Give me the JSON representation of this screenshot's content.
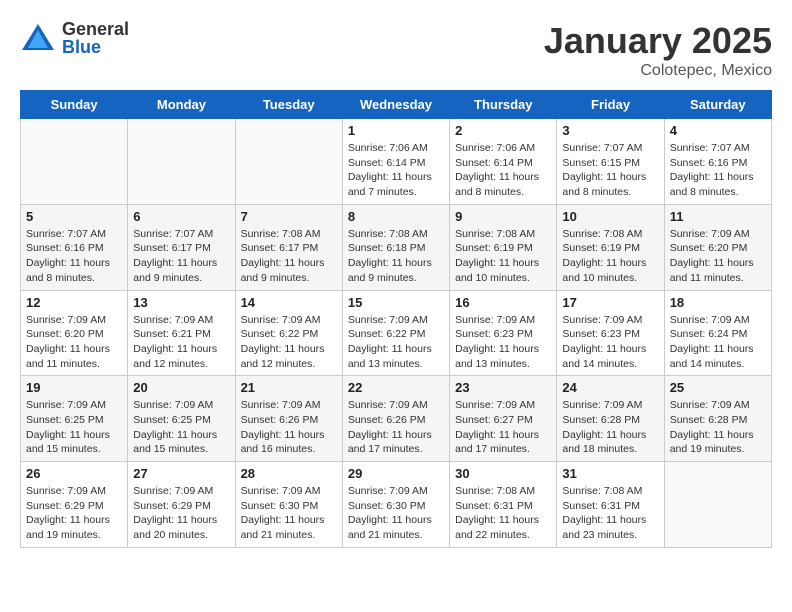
{
  "logo": {
    "general": "General",
    "blue": "Blue"
  },
  "header": {
    "title": "January 2025",
    "subtitle": "Colotepec, Mexico"
  },
  "days_of_week": [
    "Sunday",
    "Monday",
    "Tuesday",
    "Wednesday",
    "Thursday",
    "Friday",
    "Saturday"
  ],
  "weeks": [
    [
      {
        "day": "",
        "info": ""
      },
      {
        "day": "",
        "info": ""
      },
      {
        "day": "",
        "info": ""
      },
      {
        "day": "1",
        "info": "Sunrise: 7:06 AM\nSunset: 6:14 PM\nDaylight: 11 hours\nand 7 minutes."
      },
      {
        "day": "2",
        "info": "Sunrise: 7:06 AM\nSunset: 6:14 PM\nDaylight: 11 hours\nand 8 minutes."
      },
      {
        "day": "3",
        "info": "Sunrise: 7:07 AM\nSunset: 6:15 PM\nDaylight: 11 hours\nand 8 minutes."
      },
      {
        "day": "4",
        "info": "Sunrise: 7:07 AM\nSunset: 6:16 PM\nDaylight: 11 hours\nand 8 minutes."
      }
    ],
    [
      {
        "day": "5",
        "info": "Sunrise: 7:07 AM\nSunset: 6:16 PM\nDaylight: 11 hours\nand 8 minutes."
      },
      {
        "day": "6",
        "info": "Sunrise: 7:07 AM\nSunset: 6:17 PM\nDaylight: 11 hours\nand 9 minutes."
      },
      {
        "day": "7",
        "info": "Sunrise: 7:08 AM\nSunset: 6:17 PM\nDaylight: 11 hours\nand 9 minutes."
      },
      {
        "day": "8",
        "info": "Sunrise: 7:08 AM\nSunset: 6:18 PM\nDaylight: 11 hours\nand 9 minutes."
      },
      {
        "day": "9",
        "info": "Sunrise: 7:08 AM\nSunset: 6:19 PM\nDaylight: 11 hours\nand 10 minutes."
      },
      {
        "day": "10",
        "info": "Sunrise: 7:08 AM\nSunset: 6:19 PM\nDaylight: 11 hours\nand 10 minutes."
      },
      {
        "day": "11",
        "info": "Sunrise: 7:09 AM\nSunset: 6:20 PM\nDaylight: 11 hours\nand 11 minutes."
      }
    ],
    [
      {
        "day": "12",
        "info": "Sunrise: 7:09 AM\nSunset: 6:20 PM\nDaylight: 11 hours\nand 11 minutes."
      },
      {
        "day": "13",
        "info": "Sunrise: 7:09 AM\nSunset: 6:21 PM\nDaylight: 11 hours\nand 12 minutes."
      },
      {
        "day": "14",
        "info": "Sunrise: 7:09 AM\nSunset: 6:22 PM\nDaylight: 11 hours\nand 12 minutes."
      },
      {
        "day": "15",
        "info": "Sunrise: 7:09 AM\nSunset: 6:22 PM\nDaylight: 11 hours\nand 13 minutes."
      },
      {
        "day": "16",
        "info": "Sunrise: 7:09 AM\nSunset: 6:23 PM\nDaylight: 11 hours\nand 13 minutes."
      },
      {
        "day": "17",
        "info": "Sunrise: 7:09 AM\nSunset: 6:23 PM\nDaylight: 11 hours\nand 14 minutes."
      },
      {
        "day": "18",
        "info": "Sunrise: 7:09 AM\nSunset: 6:24 PM\nDaylight: 11 hours\nand 14 minutes."
      }
    ],
    [
      {
        "day": "19",
        "info": "Sunrise: 7:09 AM\nSunset: 6:25 PM\nDaylight: 11 hours\nand 15 minutes."
      },
      {
        "day": "20",
        "info": "Sunrise: 7:09 AM\nSunset: 6:25 PM\nDaylight: 11 hours\nand 15 minutes."
      },
      {
        "day": "21",
        "info": "Sunrise: 7:09 AM\nSunset: 6:26 PM\nDaylight: 11 hours\nand 16 minutes."
      },
      {
        "day": "22",
        "info": "Sunrise: 7:09 AM\nSunset: 6:26 PM\nDaylight: 11 hours\nand 17 minutes."
      },
      {
        "day": "23",
        "info": "Sunrise: 7:09 AM\nSunset: 6:27 PM\nDaylight: 11 hours\nand 17 minutes."
      },
      {
        "day": "24",
        "info": "Sunrise: 7:09 AM\nSunset: 6:28 PM\nDaylight: 11 hours\nand 18 minutes."
      },
      {
        "day": "25",
        "info": "Sunrise: 7:09 AM\nSunset: 6:28 PM\nDaylight: 11 hours\nand 19 minutes."
      }
    ],
    [
      {
        "day": "26",
        "info": "Sunrise: 7:09 AM\nSunset: 6:29 PM\nDaylight: 11 hours\nand 19 minutes."
      },
      {
        "day": "27",
        "info": "Sunrise: 7:09 AM\nSunset: 6:29 PM\nDaylight: 11 hours\nand 20 minutes."
      },
      {
        "day": "28",
        "info": "Sunrise: 7:09 AM\nSunset: 6:30 PM\nDaylight: 11 hours\nand 21 minutes."
      },
      {
        "day": "29",
        "info": "Sunrise: 7:09 AM\nSunset: 6:30 PM\nDaylight: 11 hours\nand 21 minutes."
      },
      {
        "day": "30",
        "info": "Sunrise: 7:08 AM\nSunset: 6:31 PM\nDaylight: 11 hours\nand 22 minutes."
      },
      {
        "day": "31",
        "info": "Sunrise: 7:08 AM\nSunset: 6:31 PM\nDaylight: 11 hours\nand 23 minutes."
      },
      {
        "day": "",
        "info": ""
      }
    ]
  ]
}
